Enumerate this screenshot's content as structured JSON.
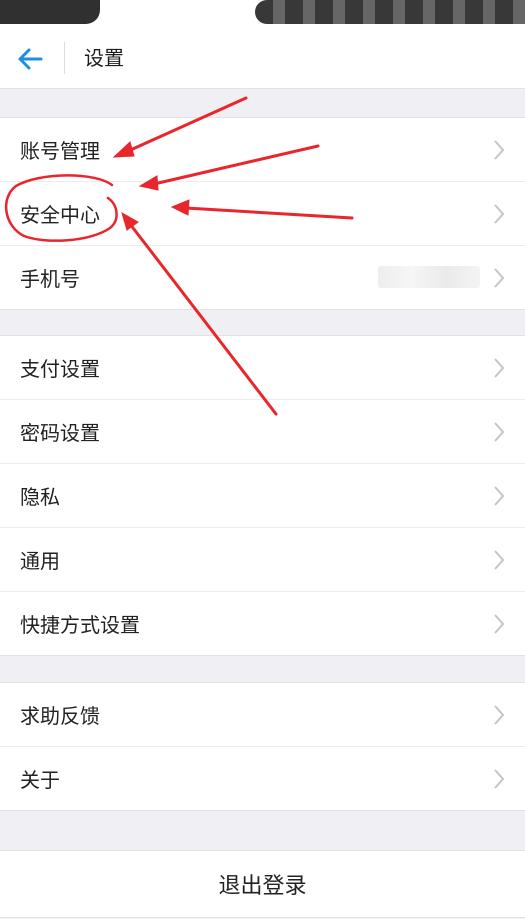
{
  "header": {
    "title": "设置",
    "back_icon": "arrow-left-icon"
  },
  "colors": {
    "accent": "#1a8fe3",
    "annotation": "#e8262b",
    "background": "#f0f0f4"
  },
  "groups": [
    {
      "items": [
        {
          "label": "账号管理"
        },
        {
          "label": "安全中心"
        },
        {
          "label": "手机号"
        }
      ]
    },
    {
      "items": [
        {
          "label": "支付设置"
        },
        {
          "label": "密码设置"
        },
        {
          "label": "隐私"
        },
        {
          "label": "通用"
        },
        {
          "label": "快捷方式设置"
        }
      ]
    },
    {
      "items": [
        {
          "label": "求助反馈"
        },
        {
          "label": "关于"
        }
      ]
    }
  ],
  "logout": {
    "label": "退出登录"
  }
}
